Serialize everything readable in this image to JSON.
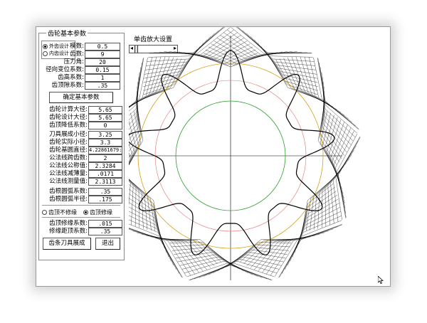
{
  "panel": {
    "title": "齿轮基本参数",
    "gear_type": [
      {
        "label": "外齿设计",
        "selected": true
      },
      {
        "label": "内齿设计",
        "selected": false
      }
    ],
    "basic_params": [
      {
        "label": "模数:",
        "value": "0.5"
      },
      {
        "label": "齿数:",
        "value": "9"
      },
      {
        "label": "压力角:",
        "value": "20"
      },
      {
        "label": "径向变位系数:",
        "value": "0.15"
      },
      {
        "label": "齿高系数:",
        "value": "1"
      },
      {
        "label": "齿顶隙系数:",
        "value": ".35"
      }
    ],
    "confirm_button": "确定基本参数",
    "computed_params": [
      {
        "label": "齿轮计算大径:",
        "value": "5.65"
      },
      {
        "label": "齿轮设计大径:",
        "value": "5.65"
      },
      {
        "label": "齿顶降低系数:",
        "value": "0"
      },
      {
        "label": "刀具展成小径:",
        "value": "3.25"
      },
      {
        "label": "齿轮实际小径:",
        "value": "3.3"
      },
      {
        "label": "齿轮基圆直径:",
        "value": "4.22861679:"
      },
      {
        "label": "公法线跨齿数:",
        "value": "2"
      },
      {
        "label": "公法线公称值:",
        "value": "2.3284"
      },
      {
        "label": "公法线减薄量:",
        "value": ".0171"
      },
      {
        "label": "公法线测量值:",
        "value": "2.3113"
      }
    ],
    "root_params": [
      {
        "label": "齿根圆弧系数:",
        "value": ".35"
      },
      {
        "label": "齿根圆弧半径:",
        "value": ".175"
      }
    ],
    "tip_mode": [
      {
        "label": "齿顶不修缘",
        "selected": false
      },
      {
        "label": "齿顶修缘",
        "selected": true
      }
    ],
    "tip_params": [
      {
        "label": "齿顶修缘系数:",
        "value": ".015"
      },
      {
        "label": "修缘距顶系数:",
        "value": ".35"
      }
    ],
    "generate_button": "齿条刀具展成",
    "exit_button": "退出"
  },
  "zoom": {
    "label": "单齿放大设置",
    "left_arrow": "◂",
    "right_arrow": "▸",
    "level": 0.0
  },
  "drawing": {
    "teeth": 9,
    "colors": {
      "envelope": "#000000",
      "tip_circle": "#d4a017",
      "ref_circle": "#e07070",
      "root_circle": "#2aa02a",
      "axis": "#000000"
    }
  }
}
